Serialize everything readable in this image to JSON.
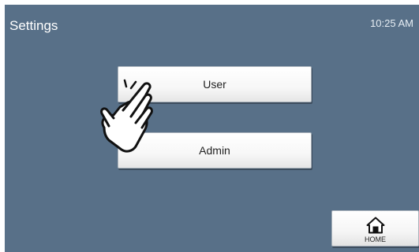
{
  "header": {
    "title": "Settings",
    "clock": "10:25 AM"
  },
  "menu": {
    "user_label": "User",
    "admin_label": "Admin"
  },
  "footer": {
    "home_label": "HOME"
  },
  "icons": {
    "home": "home-icon",
    "pointer": "pointing-hand-icon"
  },
  "colors": {
    "background": "#587088",
    "button_face": "#ffffff",
    "text_light": "#ffffff"
  }
}
